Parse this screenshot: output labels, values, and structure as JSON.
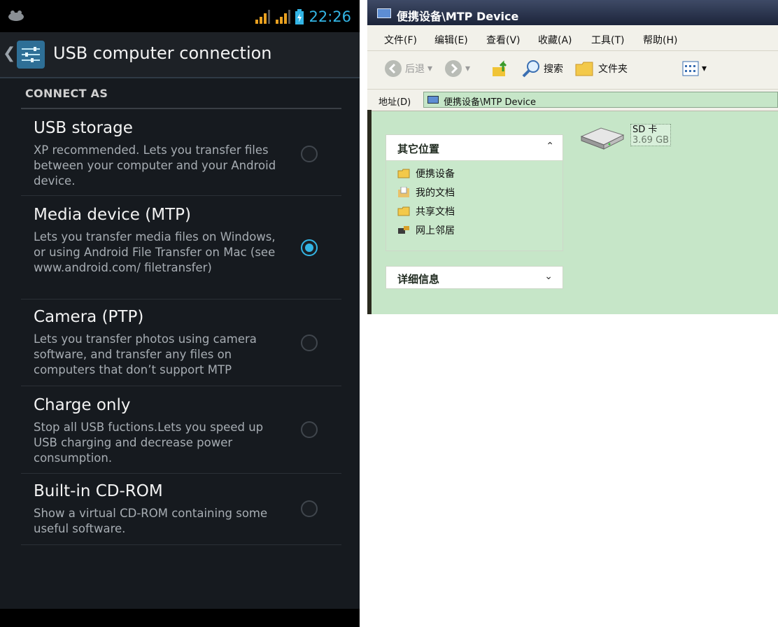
{
  "android": {
    "status_time": "22:26",
    "title": "USB computer connection",
    "section_header": "CONNECT AS",
    "accent_color": "#33b5e5",
    "options": [
      {
        "title": "USB storage",
        "summary": "XP recommended. Lets you transfer files between your computer and your Android device.",
        "selected": false
      },
      {
        "title": "Media device (MTP)",
        "summary": "Lets you transfer media files on Windows, or using Android File Transfer on Mac (see www.android.com/ filetransfer)",
        "selected": true
      },
      {
        "title": "Camera (PTP)",
        "summary": "Lets you transfer photos using camera software, and transfer any files on computers that don’t support MTP",
        "selected": false
      },
      {
        "title": "Charge only",
        "summary": "Stop all USB fuctions.Lets you speed up USB charging and decrease power consumption.",
        "selected": false
      },
      {
        "title": "Built-in CD-ROM",
        "summary": "Show a virtual CD-ROM containing some useful software.",
        "selected": false
      }
    ]
  },
  "explorer": {
    "window_title": "便携设备\\MTP Device",
    "menu": [
      "文件(F)",
      "编辑(E)",
      "查看(V)",
      "收藏(A)",
      "工具(T)",
      "帮助(H)"
    ],
    "toolbar": {
      "back": "后退",
      "search": "搜索",
      "folders": "文件夹"
    },
    "address_label": "地址(D)",
    "address_value": "便携设备\\MTP Device",
    "other_places": {
      "header": "其它位置",
      "items": [
        "便携设备",
        "我的文档",
        "共享文档",
        "网上邻居"
      ]
    },
    "details": {
      "header": "详细信息"
    },
    "drive": {
      "name": "SD 卡",
      "size": "3.69 GB"
    }
  }
}
